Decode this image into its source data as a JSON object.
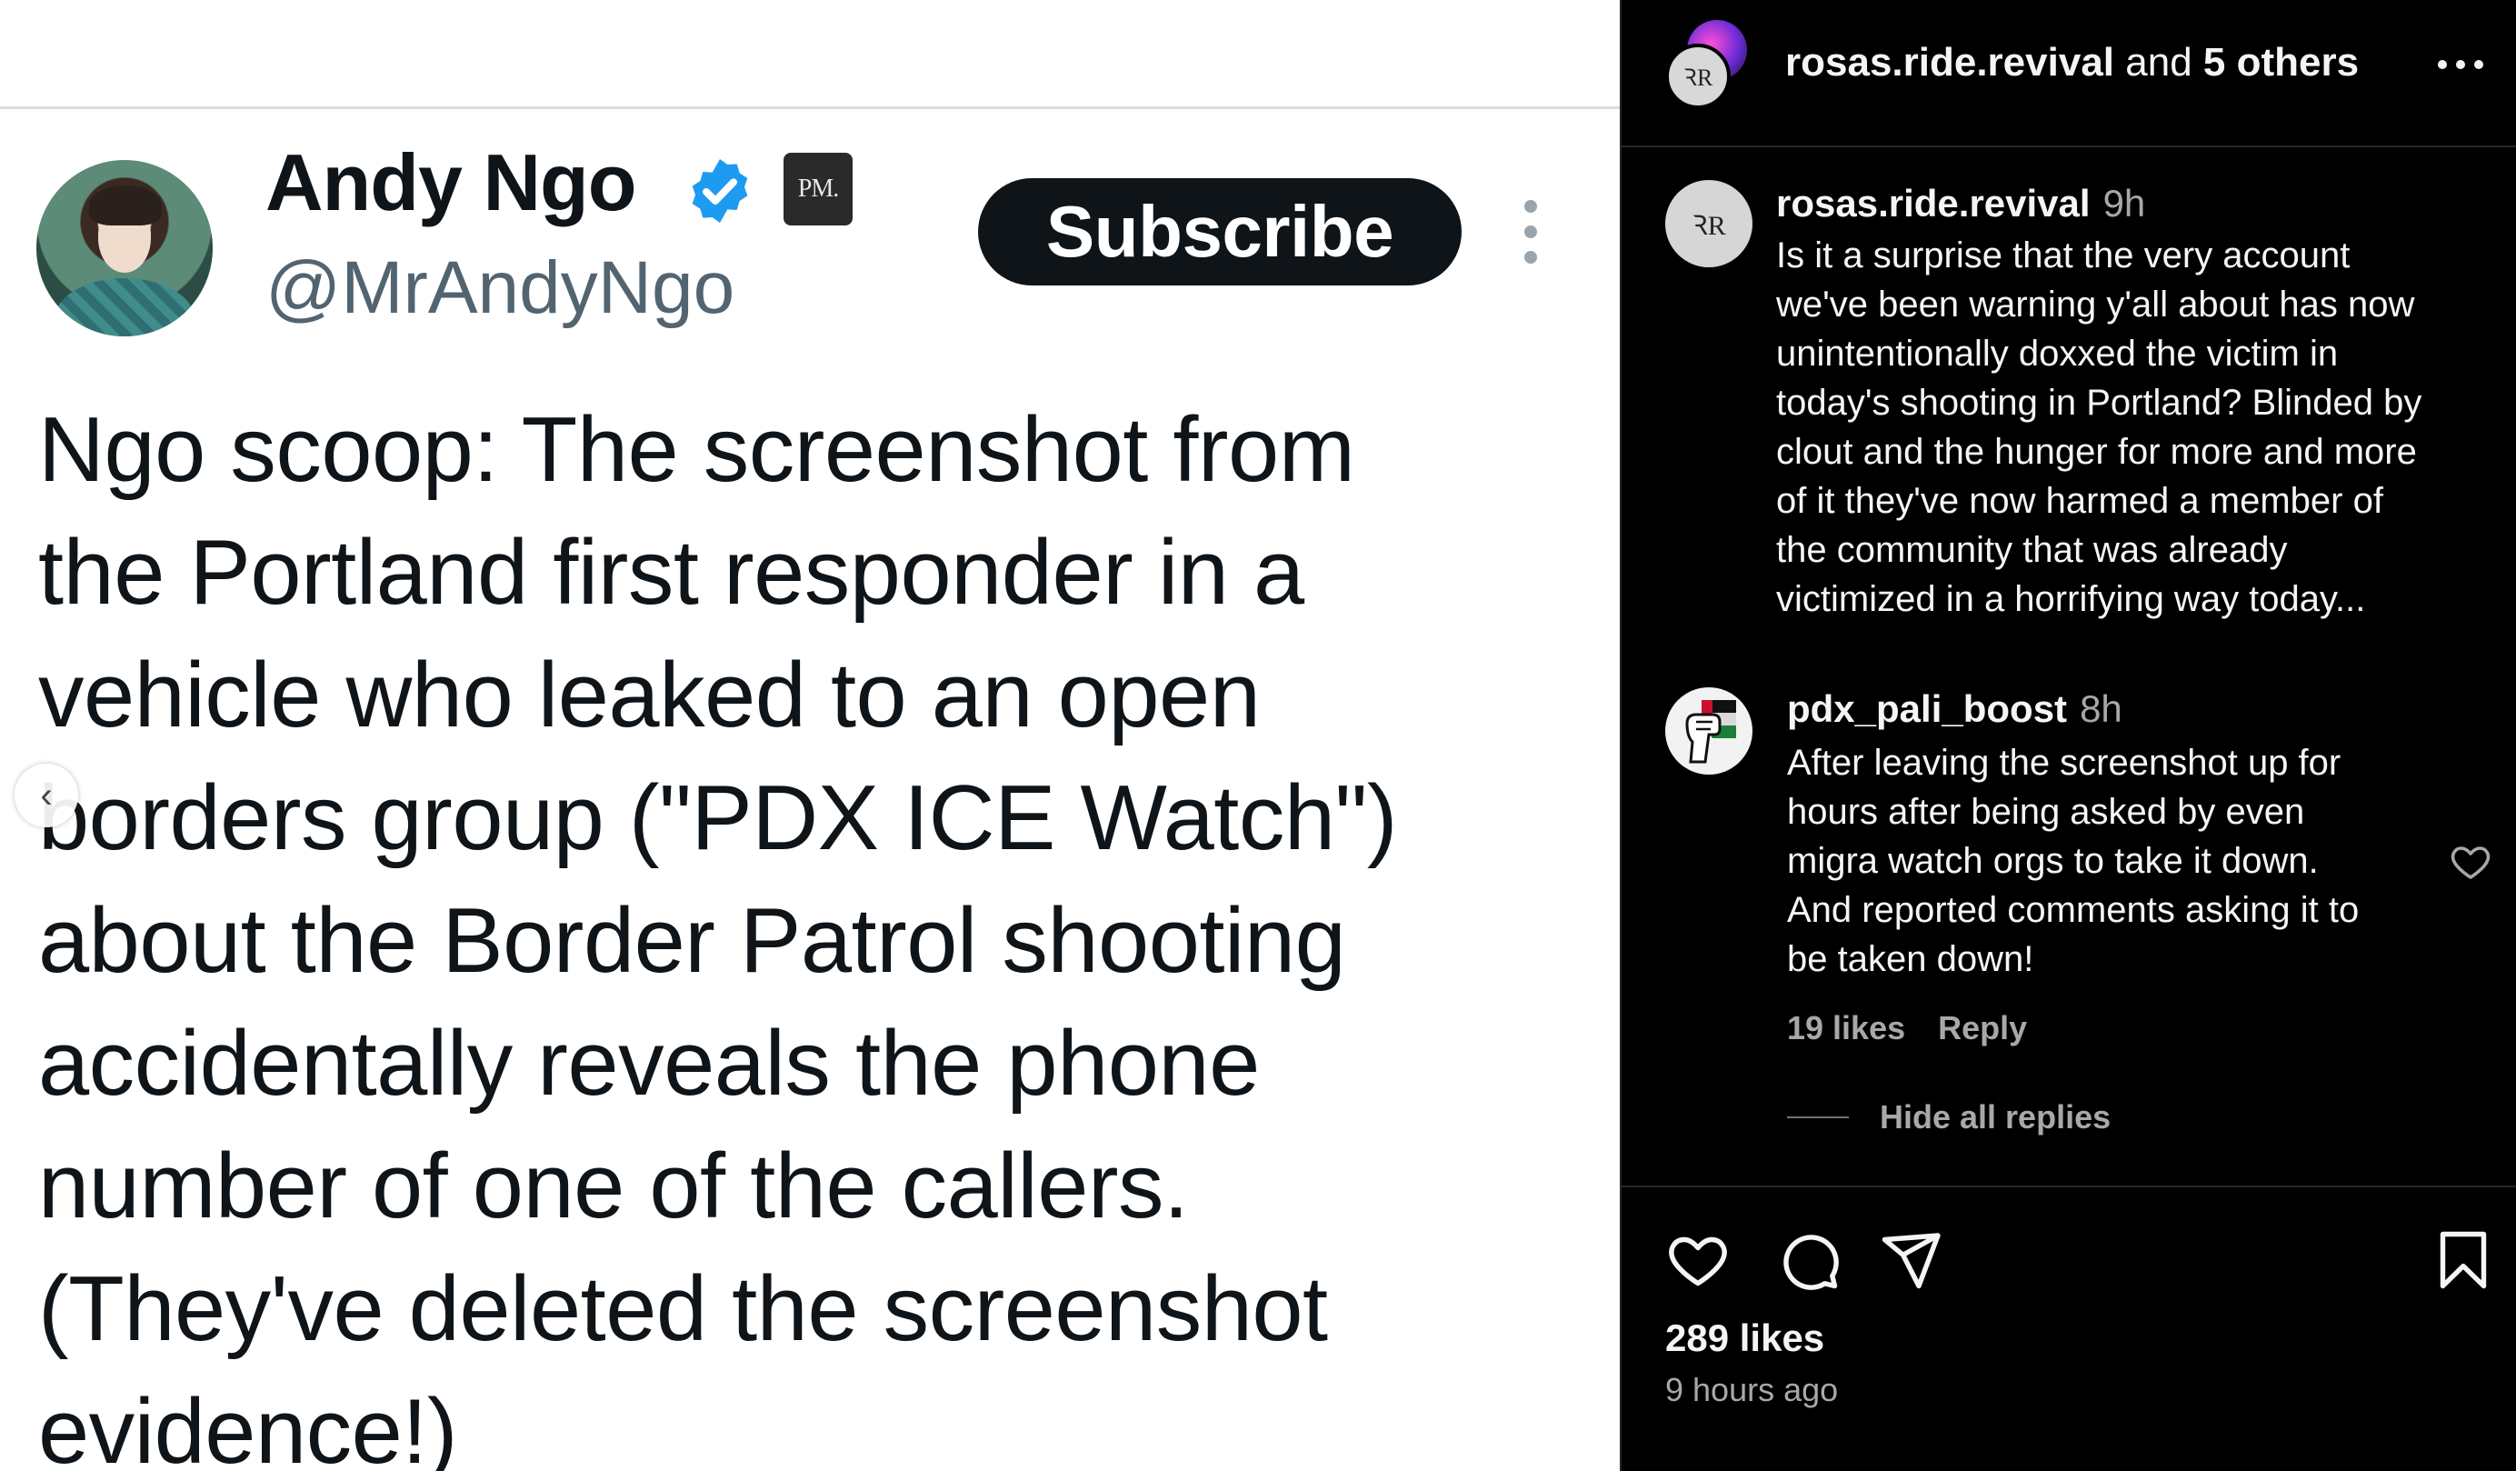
{
  "tweet": {
    "author_name": "Andy Ngo",
    "handle": "@MrAndyNgo",
    "affiliate_badge": "PM.",
    "subscribe_label": "Subscribe",
    "body_lines": [
      "Ngo scoop: The screenshot from",
      "the Portland first responder in a",
      "vehicle who leaked to an open",
      "borders group (\"PDX ICE Watch\")",
      "about the Border Patrol shooting",
      "accidentally reveals the phone",
      "number of one of the callers.",
      "(They've deleted the screenshot",
      "evidence!)"
    ],
    "verified_color": "#1d9bf0",
    "icons": [
      "verified-icon",
      "more-vertical-icon"
    ]
  },
  "carousel": {
    "prev_icon": "chevron-left-icon"
  },
  "panel": {
    "header": {
      "username": "rosas.ride.revival",
      "joiner": "and",
      "others": "5 others",
      "avatar_monogram": "ꝚR"
    },
    "comments": [
      {
        "username": "rosas.ride.revival",
        "time": "9h",
        "avatar_monogram": "ꝚR",
        "lines": [
          "Is it a surprise that the very account",
          "we've been warning y'all about has now",
          "unintentionally doxxed the victim in",
          "today's shooting in Portland? Blinded by",
          "clout and the hunger for more and more",
          "of it they've now harmed a member of",
          "the community that was already",
          "victimized in a horrifying way today..."
        ]
      },
      {
        "username": "pdx_pali_boost",
        "time": "8h",
        "lines": [
          "After leaving the screenshot up for",
          "hours after being asked by even",
          "migra watch orgs to take it down.",
          "And reported comments asking it to",
          "be taken down!"
        ],
        "likes": "19 likes",
        "reply_label": "Reply",
        "hide_replies_label": "Hide all replies"
      }
    ],
    "likes": "289 likes",
    "time_ago": "9 hours ago",
    "colors": {
      "background": "#000000",
      "secondary_text": "#a8a8a8",
      "divider": "#262626"
    }
  }
}
